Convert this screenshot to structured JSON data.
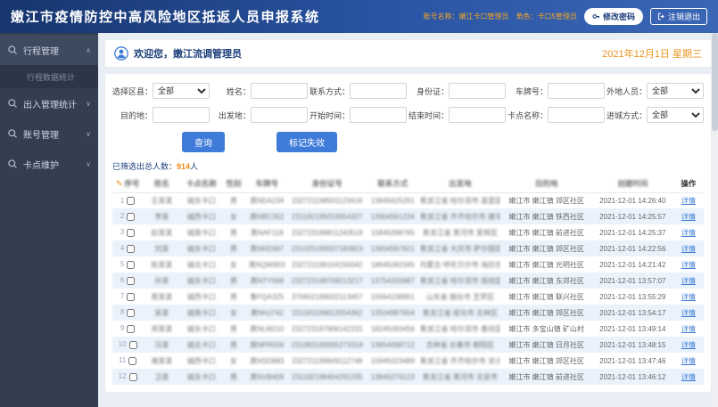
{
  "app": {
    "title": "嫩江市疫情防控中高风险地区抵返人员申报系统"
  },
  "header": {
    "account_text": "账号名称：嫩江卡口管理员　角色：卡口5管理员",
    "change_password_label": "修改密码",
    "logout_label": "注销退出"
  },
  "icons": {
    "caret_up": "∧",
    "caret_down": "∨",
    "pencil": "✎"
  },
  "sidebar": {
    "items": [
      {
        "label": "行程管理",
        "children": [
          {
            "label": "行程数据统计"
          }
        ]
      },
      {
        "label": "出入管理统计"
      },
      {
        "label": "账号管理"
      },
      {
        "label": "卡点维护"
      }
    ]
  },
  "welcome": {
    "greeting": "欢迎您，嫩江流调管理员",
    "date": "2021年12月1日 星期三"
  },
  "filters": {
    "fields": [
      {
        "key": "region",
        "label": "选择区县：",
        "type": "select",
        "value": "全部"
      },
      {
        "key": "name",
        "label": "姓名：",
        "type": "input",
        "value": ""
      },
      {
        "key": "contact",
        "label": "联系方式：",
        "type": "input",
        "value": ""
      },
      {
        "key": "id-card",
        "label": "身份证：",
        "type": "input",
        "value": ""
      },
      {
        "key": "plate",
        "label": "车牌号：",
        "type": "input",
        "value": ""
      },
      {
        "key": "outsider",
        "label": "外地人员：",
        "type": "select",
        "value": "全部"
      },
      {
        "key": "destination",
        "label": "目的地：",
        "type": "input",
        "value": ""
      },
      {
        "key": "origin",
        "label": "出发地：",
        "type": "input",
        "value": ""
      },
      {
        "key": "start-time",
        "label": "开始时间：",
        "type": "input",
        "value": ""
      },
      {
        "key": "end-time",
        "label": "结束时间：",
        "type": "input",
        "value": ""
      },
      {
        "key": "checkpoint",
        "label": "卡点名称：",
        "type": "input",
        "value": ""
      },
      {
        "key": "entry-mode",
        "label": "进城方式：",
        "type": "select",
        "value": "全部"
      }
    ],
    "query_label": "查询",
    "mark_invalid_label": "标记失效"
  },
  "summary": {
    "prefix": "已筛选出总人数：",
    "count": "914",
    "suffix": "人"
  },
  "table": {
    "headers": [
      "序号",
      "姓名",
      "卡点名称",
      "性别",
      "车牌号",
      "身份证号",
      "联系方式",
      "出发地",
      "目的地",
      "创建时间",
      "操作"
    ],
    "detail_label": "详情",
    "rows": [
      {
        "num": "1",
        "name": "王某某",
        "checkpoint": "城东卡口",
        "gender": "男",
        "plate": "黑NDA234",
        "id_number": "232721198501123416",
        "phone": "13845625261",
        "origin": "黑龙江省 哈尔滨市 道里区",
        "destination": "嫩江市 嫩江镇 郊区社区",
        "created": "2021-12-01 14:26:40"
      },
      {
        "num": "2",
        "name": "李某",
        "checkpoint": "城西卡口",
        "gender": "女",
        "plate": "黑NBC352",
        "id_number": "231182199203054327",
        "phone": "13904561234",
        "origin": "黑龙江省 齐齐哈尔市 建华区",
        "destination": "嫩江市 嫩江镇 铁西社区",
        "created": "2021-12-01 14:25:57"
      },
      {
        "num": "3",
        "name": "赵某某",
        "checkpoint": "城南卡口",
        "gender": "男",
        "plate": "黑NAF118",
        "id_number": "232723198811243519",
        "phone": "15845098765",
        "origin": "黑龙江省 黑河市 爱辉区",
        "destination": "嫩江市 嫩江镇 前进社区",
        "created": "2021-12-01 14:25:37"
      },
      {
        "num": "4",
        "name": "刘某",
        "checkpoint": "城东卡口",
        "gender": "男",
        "plate": "黑NKE667",
        "id_number": "231025199507183823",
        "phone": "13604567821",
        "origin": "黑龙江省 大庆市 萨尔图区",
        "destination": "嫩江市 嫩江镇 郊区社区",
        "created": "2021-12-01 14:22:56"
      },
      {
        "num": "5",
        "name": "陈某某",
        "checkpoint": "城北卡口",
        "gender": "女",
        "plate": "黑NQW903",
        "id_number": "232721199104150042",
        "phone": "18645092345",
        "origin": "内蒙古 呼伦贝尔市 海拉尔区",
        "destination": "嫩江市 嫩江镇 光明社区",
        "created": "2021-12-01 14:21:42"
      },
      {
        "num": "6",
        "name": "孙某",
        "checkpoint": "城东卡口",
        "gender": "男",
        "plate": "黑NTY568",
        "id_number": "232723198709213217",
        "phone": "13754320987",
        "origin": "黑龙江省 哈尔滨市 南岗区",
        "destination": "嫩江市 嫩江镇 东郊社区",
        "created": "2021-12-01 13:57:07"
      },
      {
        "num": "7",
        "name": "周某某",
        "checkpoint": "城西卡口",
        "gender": "男",
        "plate": "鲁FQA325",
        "id_number": "370602199002113457",
        "phone": "15064238901",
        "origin": "山东省 烟台市 芝罘区",
        "destination": "嫩江市 嫩江镇 联兴社区",
        "created": "2021-12-01 13:55:29"
      },
      {
        "num": "8",
        "name": "吴某",
        "checkpoint": "城南卡口",
        "gender": "女",
        "plate": "黑NHJ742",
        "id_number": "231181199812054362",
        "phone": "13504987654",
        "origin": "黑龙江省 绥化市 北林区",
        "destination": "嫩江市 嫩江镇 郊区社区",
        "created": "2021-12-01 13:54:17"
      },
      {
        "num": "9",
        "name": "郑某某",
        "checkpoint": "城东卡口",
        "gender": "男",
        "plate": "黑NLM210",
        "id_number": "232723197906142231",
        "phone": "18245093456",
        "origin": "黑龙江省 哈尔滨市 香坊区",
        "destination": "嫩江市 多宝山镇 矿山村",
        "created": "2021-12-01 13:49:14"
      },
      {
        "num": "10",
        "name": "冯某",
        "checkpoint": "城北卡口",
        "gender": "男",
        "plate": "黑NPR556",
        "id_number": "231083199305273318",
        "phone": "13654098712",
        "origin": "吉林省 长春市 朝阳区",
        "destination": "嫩江市 嫩江镇 日月社区",
        "created": "2021-12-01 13:48:15"
      },
      {
        "num": "11",
        "name": "褚某某",
        "checkpoint": "城西卡口",
        "gender": "女",
        "plate": "黑NSD883",
        "id_number": "232721199609112748",
        "phone": "15945023489",
        "origin": "黑龙江省 齐齐哈尔市 龙沙区",
        "destination": "嫩江市 嫩江镇 郊区社区",
        "created": "2021-12-01 13:47:46"
      },
      {
        "num": "12",
        "name": "卫某",
        "checkpoint": "城东卡口",
        "gender": "男",
        "plate": "黑NVB409",
        "id_number": "231182198404291335",
        "phone": "13845076123",
        "origin": "黑龙江省 黑河市 北安市",
        "destination": "嫩江市 嫩江镇 前进社区",
        "created": "2021-12-01 13:46:12"
      }
    ]
  },
  "colors": {
    "header_bg": "#17356e",
    "accent_blue": "#3f7bd9",
    "accent_orange": "#f08c1a"
  }
}
